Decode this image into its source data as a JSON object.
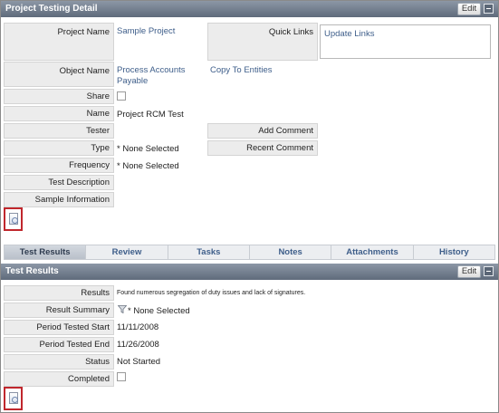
{
  "detail_panel": {
    "title": "Project Testing Detail",
    "edit_label": "Edit",
    "fields": {
      "project_name_label": "Project Name",
      "project_name_value": "Sample Project",
      "object_name_label": "Object Name",
      "object_name_value_line1": "Process Accounts",
      "object_name_value_line2": "Payable",
      "share_label": "Share",
      "share_checked": false,
      "name_label": "Name",
      "name_value": "Project RCM Test",
      "tester_label": "Tester",
      "tester_value": "",
      "type_label": "Type",
      "type_value": "* None Selected",
      "frequency_label": "Frequency",
      "frequency_value": "* None Selected",
      "test_description_label": "Test Description",
      "sample_information_label": "Sample Information"
    },
    "quick_links_label": "Quick Links",
    "update_links": "Update Links",
    "copy_to_entities": "Copy To Entities",
    "add_comment": "Add Comment",
    "recent_comment": "Recent Comment"
  },
  "tabs": [
    {
      "label": "Test Results",
      "active": true
    },
    {
      "label": "Review",
      "active": false
    },
    {
      "label": "Tasks",
      "active": false
    },
    {
      "label": "Notes",
      "active": false
    },
    {
      "label": "Attachments",
      "active": false
    },
    {
      "label": "History",
      "active": false
    }
  ],
  "results_panel": {
    "title": "Test Results",
    "edit_label": "Edit",
    "fields": {
      "results_label": "Results",
      "results_value": "Found numerous segregation of duty issues and lack of signatures.",
      "result_summary_label": "Result Summary",
      "result_summary_value": "* None Selected",
      "period_start_label": "Period Tested Start",
      "period_start_value": "11/11/2008",
      "period_end_label": "Period Tested End",
      "period_end_value": "11/26/2008",
      "status_label": "Status",
      "status_value": "Not Started",
      "completed_label": "Completed",
      "completed_checked": false
    }
  },
  "colors": {
    "header_bg": "#6f7b8b",
    "link": "#3e5e8a",
    "label_bg": "#ececec",
    "highlight_border": "#c0272d"
  }
}
